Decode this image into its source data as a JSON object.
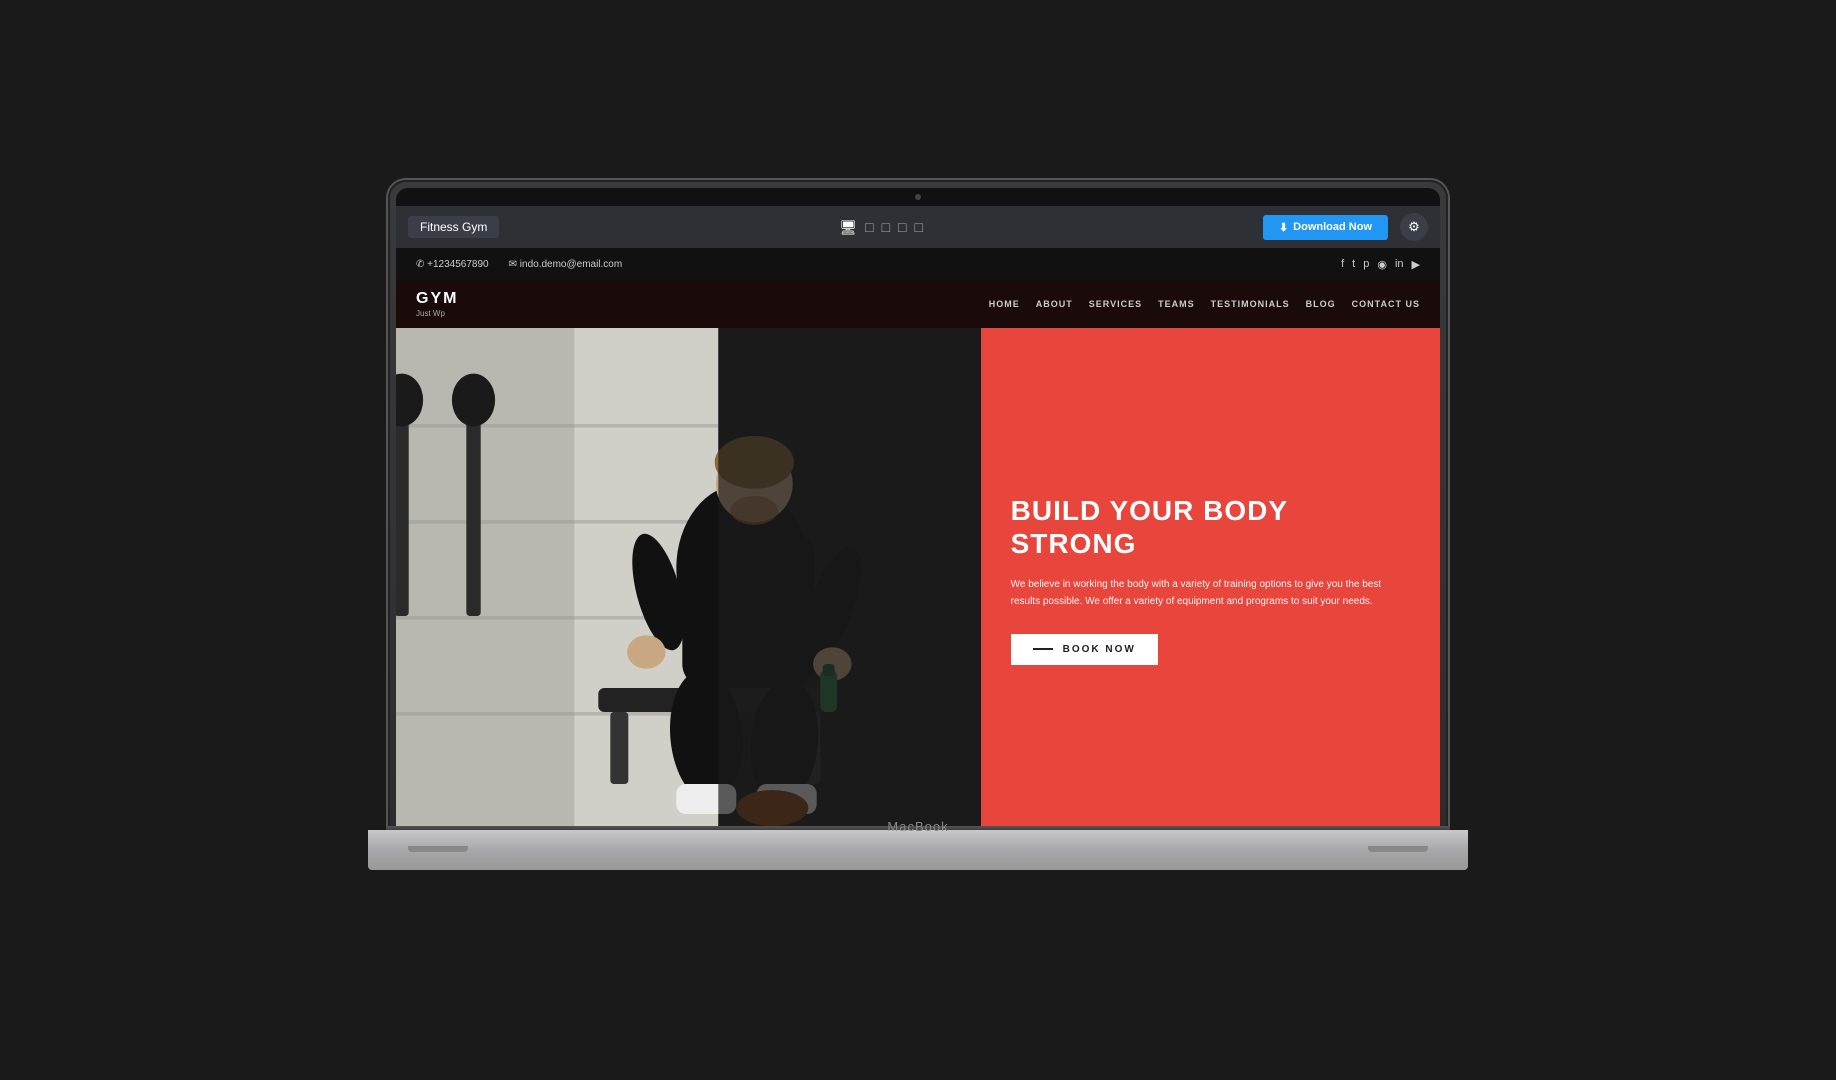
{
  "toolbar": {
    "title": "Fitness Gym",
    "download_label": "Download Now",
    "download_icon": "⬇",
    "settings_icon": "⚙"
  },
  "devices": [
    {
      "name": "desktop",
      "icon": "🖥",
      "active": true
    },
    {
      "name": "laptop",
      "icon": "💻",
      "active": false
    },
    {
      "name": "tablet",
      "icon": "📱",
      "active": false
    },
    {
      "name": "tablet-small",
      "icon": "📟",
      "active": false
    },
    {
      "name": "mobile",
      "icon": "📱",
      "active": false
    }
  ],
  "contact_bar": {
    "phone": "✆ +1234567890",
    "email": "✉ indo.demo@email.com",
    "socials": [
      "f",
      "t",
      "p",
      "◉",
      "in",
      "▶"
    ]
  },
  "nav": {
    "logo": "GYM",
    "tagline": "Just Wp",
    "links": [
      "HOME",
      "ABOUT",
      "SERVICES",
      "TEAMS",
      "TESTIMONIALS",
      "BLOG",
      "CONTACT US"
    ]
  },
  "hero": {
    "headline_line1": "BUILD YOUR BODY",
    "headline_line2": "STRONG",
    "description": "We believe in working the body with a variety of training options to give you the best results possible. We offer a variety of equipment and programs to suit your needs.",
    "book_button": "BOOK NOW"
  },
  "macbook": {
    "label": "MacBook"
  },
  "colors": {
    "hero_bg": "#e8453c",
    "toolbar_bg": "#2d3035",
    "contact_bar_bg": "#111",
    "nav_bg": "#1a0a0a",
    "download_btn": "#2196f3"
  }
}
